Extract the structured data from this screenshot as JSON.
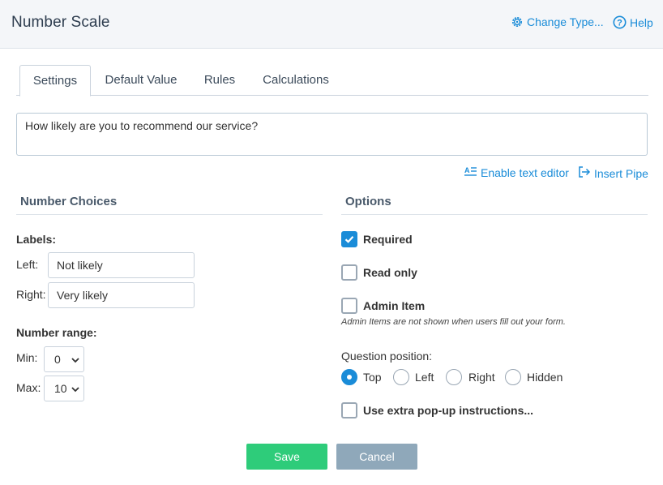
{
  "header": {
    "title": "Number Scale",
    "change_type_label": "Change Type...",
    "help_label": "Help"
  },
  "tabs": [
    {
      "label": "Settings",
      "active": true
    },
    {
      "label": "Default Value",
      "active": false
    },
    {
      "label": "Rules",
      "active": false
    },
    {
      "label": "Calculations",
      "active": false
    }
  ],
  "question": {
    "text": "How likely are you to recommend our service?"
  },
  "tools": {
    "enable_text_editor": "Enable text editor",
    "insert_pipe": "Insert Pipe"
  },
  "number_choices": {
    "title": "Number Choices",
    "labels_heading": "Labels:",
    "left_label": "Left:",
    "left_value": "Not likely",
    "right_label": "Right:",
    "right_value": "Very likely",
    "range_heading": "Number range:",
    "min_label": "Min:",
    "min_value": "0",
    "max_label": "Max:",
    "max_value": "10"
  },
  "options": {
    "title": "Options",
    "required": {
      "label": "Required",
      "checked": true
    },
    "read_only": {
      "label": "Read only",
      "checked": false
    },
    "admin_item": {
      "label": "Admin Item",
      "checked": false,
      "help": "Admin Items are not shown when users fill out your form."
    },
    "question_position": {
      "label": "Question position:",
      "choices": [
        {
          "label": "Top",
          "selected": true
        },
        {
          "label": "Left",
          "selected": false
        },
        {
          "label": "Right",
          "selected": false
        },
        {
          "label": "Hidden",
          "selected": false
        }
      ]
    },
    "popup": {
      "label": "Use extra pop-up instructions...",
      "checked": false
    }
  },
  "footer": {
    "save_label": "Save",
    "cancel_label": "Cancel"
  },
  "colors": {
    "accent": "#1a8cd8",
    "save": "#2ecc7a",
    "cancel": "#8fa8ba"
  }
}
